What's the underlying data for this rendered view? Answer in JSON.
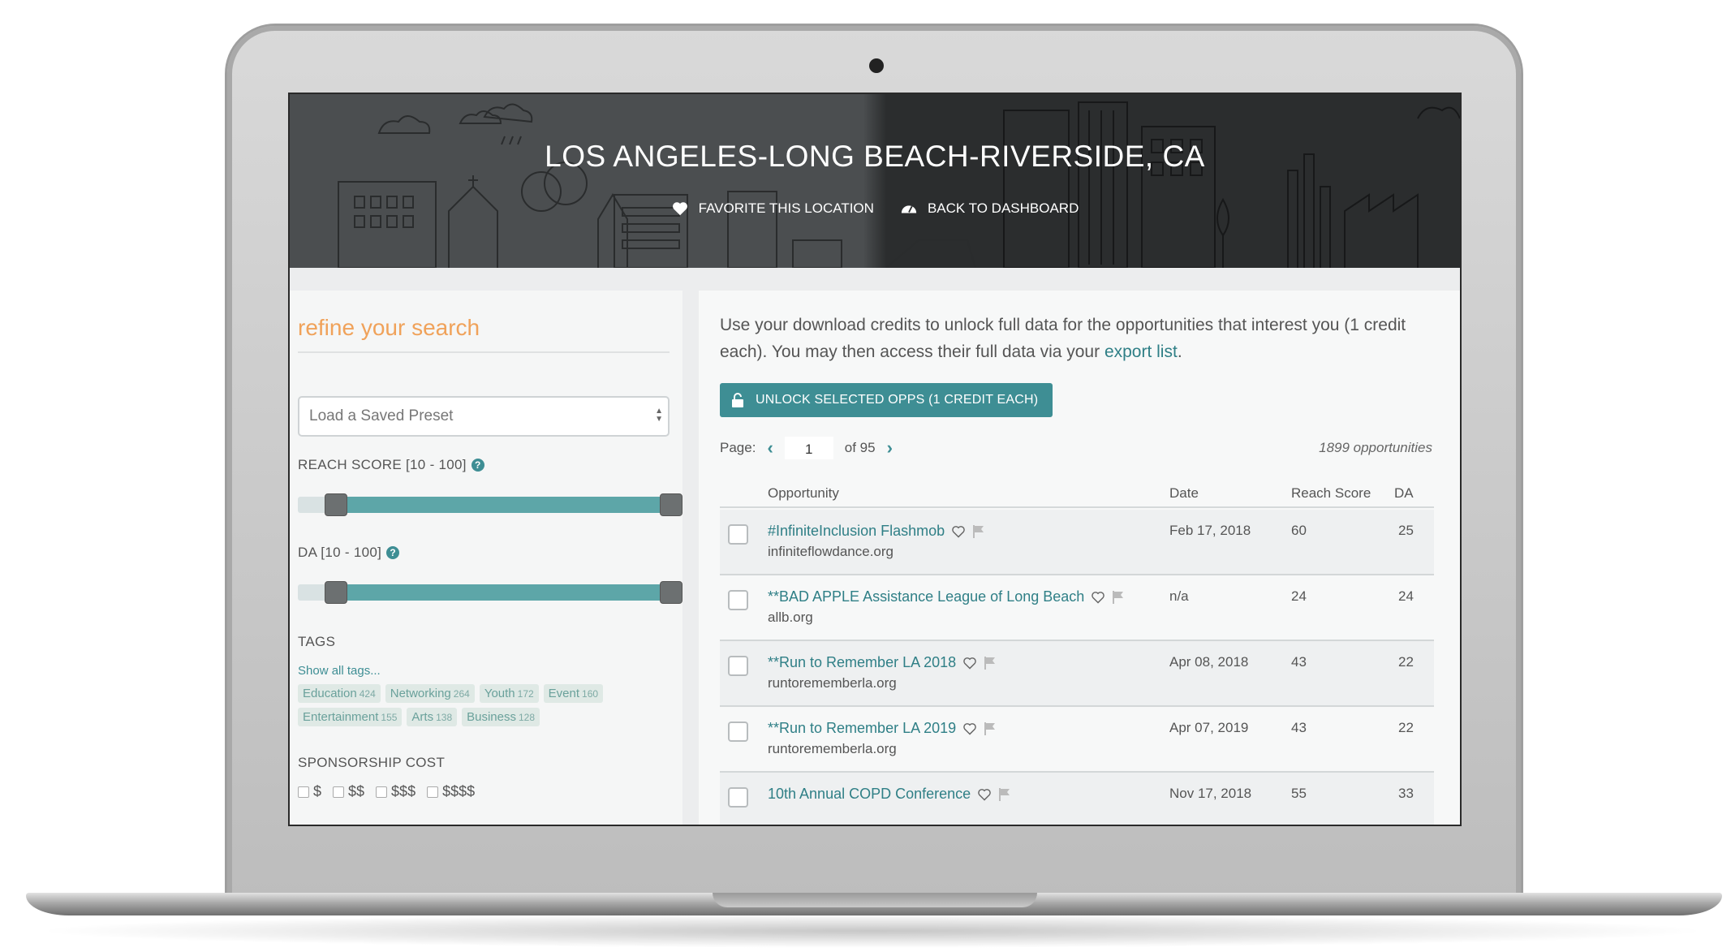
{
  "header": {
    "title": "LOS ANGELES-LONG BEACH-RIVERSIDE, CA",
    "favorite_label": "FAVORITE THIS LOCATION",
    "dashboard_label": "BACK TO DASHBOARD"
  },
  "sidebar": {
    "title": "refine your search",
    "preset_placeholder": "Load a Saved Preset",
    "reach_label": "REACH SCORE [10 - 100]",
    "da_label": "DA [10 - 100]",
    "tags_label": "TAGS",
    "show_all_tags": "Show all tags...",
    "tags": [
      {
        "name": "Education",
        "count": "424"
      },
      {
        "name": "Networking",
        "count": "264"
      },
      {
        "name": "Youth",
        "count": "172"
      },
      {
        "name": "Event",
        "count": "160"
      },
      {
        "name": "Entertainment",
        "count": "155"
      },
      {
        "name": "Arts",
        "count": "138"
      },
      {
        "name": "Business",
        "count": "128"
      }
    ],
    "cost_label": "SPONSORSHIP COST",
    "cost_options": [
      "$",
      "$$",
      "$$$",
      "$$$$"
    ]
  },
  "main": {
    "intro_text": "Use your download credits to unlock full data for the opportunities that interest you (1 credit each). You may then access their full data via your ",
    "intro_link": "export list",
    "intro_end": ".",
    "unlock_label": "UNLOCK SELECTED OPPS (1 CREDIT EACH)",
    "page_label": "Page:",
    "page_value": "1",
    "page_of": "of 95",
    "opp_count": "1899 opportunities",
    "columns": {
      "opportunity": "Opportunity",
      "date": "Date",
      "reach": "Reach Score",
      "da": "DA"
    },
    "rows": [
      {
        "name": "#InfiniteInclusion Flashmob",
        "domain": "infiniteflowdance.org",
        "date": "Feb 17, 2018",
        "reach": "60",
        "da": "25"
      },
      {
        "name": "**BAD APPLE Assistance League of Long Beach",
        "domain": "allb.org",
        "date": "n/a",
        "reach": "24",
        "da": "24"
      },
      {
        "name": "**Run to Remember LA 2018",
        "domain": "runtorememberla.org",
        "date": "Apr 08, 2018",
        "reach": "43",
        "da": "22"
      },
      {
        "name": "**Run to Remember LA 2019",
        "domain": "runtorememberla.org",
        "date": "Apr 07, 2019",
        "reach": "43",
        "da": "22"
      },
      {
        "name": "10th Annual COPD Conference",
        "domain": "",
        "date": "Nov 17, 2018",
        "reach": "55",
        "da": "33"
      }
    ]
  },
  "colors": {
    "accent": "#3e8e94",
    "title_orange": "#f0a25a",
    "slider_fill": "#5da6a8"
  },
  "icons": [
    "heart-icon",
    "dashboard-gauge-icon",
    "lock-icon",
    "flag-icon",
    "help-icon",
    "chevron-left-icon",
    "chevron-right-icon"
  ]
}
